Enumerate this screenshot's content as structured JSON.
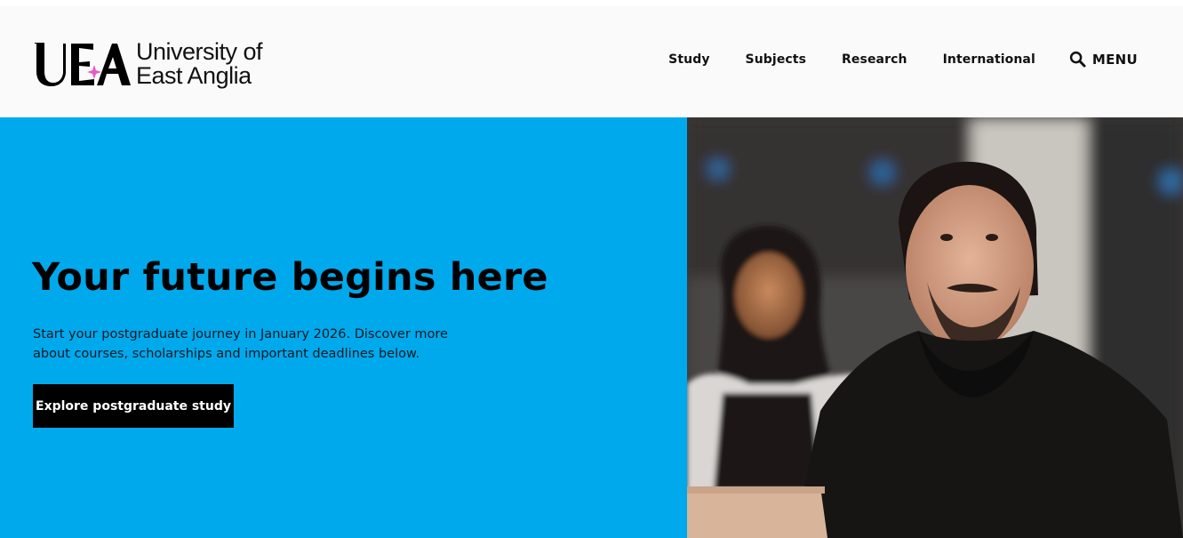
{
  "header": {
    "logo_line1": "University of",
    "logo_line2": "East Anglia",
    "nav": [
      "Study",
      "Subjects",
      "Research",
      "International"
    ],
    "menu_label": "MENU"
  },
  "hero": {
    "title": "Your future begins here",
    "description": "Start your postgraduate journey in January 2026. Discover more about courses, scholarships and important deadlines below.",
    "cta_label": "Explore postgraduate study"
  },
  "colors": {
    "hero_background": "#00a9ec",
    "logo_star": "#e85cc4",
    "cta_background": "#000000",
    "header_background": "#fafafa"
  },
  "icons": {
    "menu_search": "search-icon",
    "logo_star": "sparkle-star-icon"
  }
}
